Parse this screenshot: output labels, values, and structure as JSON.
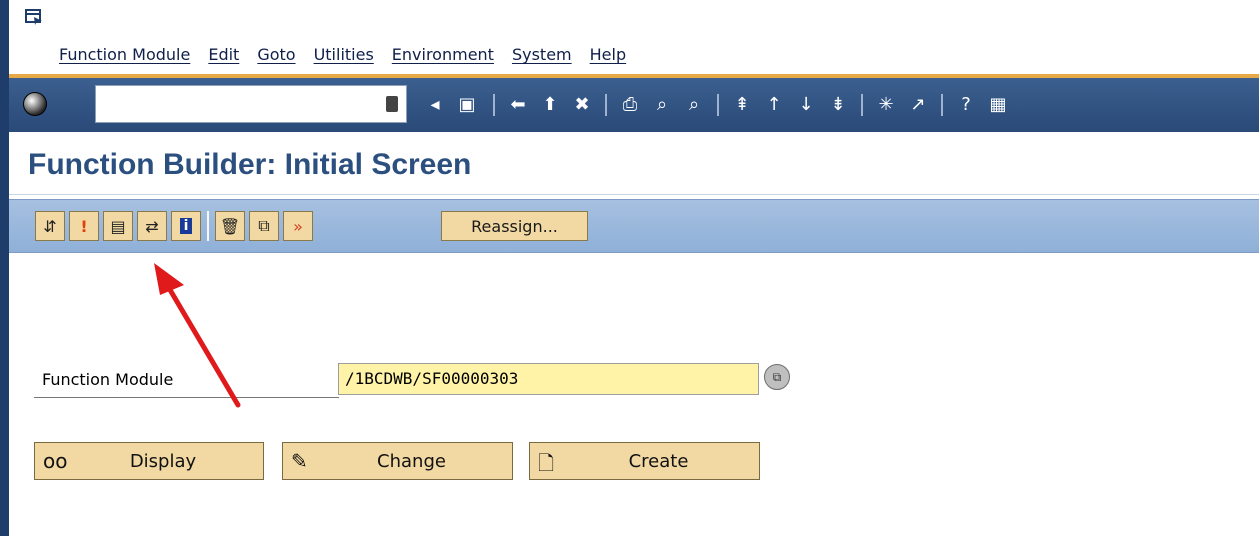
{
  "menu": {
    "items": [
      "Function Module",
      "Edit",
      "Goto",
      "Utilities",
      "Environment",
      "System",
      "Help"
    ]
  },
  "toolbar": {
    "command_field_value": "",
    "icons": [
      "ok-check-icon",
      "dropdown-icon",
      "back-arrow-icon",
      "save-icon",
      "back-icon",
      "exit-icon",
      "cancel-icon",
      "print-icon",
      "find-icon",
      "find-next-icon",
      "first-page-icon",
      "previous-page-icon",
      "next-page-icon",
      "last-page-icon",
      "new-session-icon",
      "shortcut-icon",
      "help-icon",
      "layout-icon"
    ]
  },
  "title": "Function Builder: Initial Screen",
  "app_toolbar": {
    "icons": [
      "where-used-icon",
      "test-icon",
      "display-object-list-icon",
      "navigation-icon",
      "info-icon",
      "delete-icon",
      "copy-icon",
      "rename-icon"
    ],
    "reassign_label": "Reassign..."
  },
  "form": {
    "function_module_label": "Function Module",
    "function_module_value": "/1BCDWB/SF00000303"
  },
  "buttons": {
    "display": "Display",
    "change": "Change",
    "create": "Create"
  },
  "colors": {
    "accent_orange": "#e6a945",
    "title_blue": "#2b4f7e",
    "input_yellow": "#fef3a6",
    "button_beige": "#f2d9a3",
    "arrow_red": "#e0191b"
  }
}
